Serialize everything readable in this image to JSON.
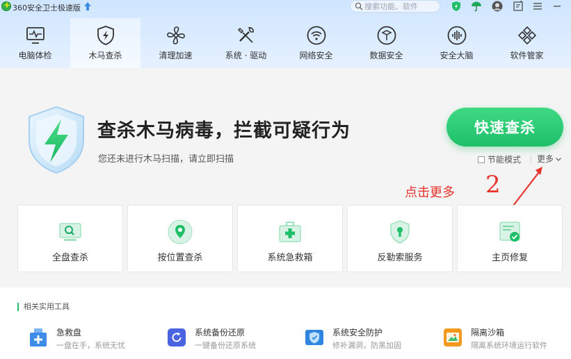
{
  "app": {
    "title": "360安全卫士极速版"
  },
  "search": {
    "placeholder": "搜索功能、软件"
  },
  "nav": [
    {
      "label": "电脑体检"
    },
    {
      "label": "木马查杀"
    },
    {
      "label": "清理加速"
    },
    {
      "label": "系统 · 驱动"
    },
    {
      "label": "网络安全"
    },
    {
      "label": "数据安全"
    },
    {
      "label": "安全大脑"
    },
    {
      "label": "软件管家"
    }
  ],
  "hero": {
    "headline": "查杀木马病毒，拦截可疑行为",
    "subtext": "您还未进行木马扫描，请立即扫描",
    "scan_button": "快速查杀",
    "power_save": "节能模式",
    "more": "更多"
  },
  "annotation": {
    "text": "点击更多",
    "number": "2",
    "color": "#e8332b"
  },
  "cards": [
    {
      "label": "全盘查杀"
    },
    {
      "label": "按位置查杀"
    },
    {
      "label": "系统急救箱"
    },
    {
      "label": "反勒索服务"
    },
    {
      "label": "主页修复"
    }
  ],
  "related": {
    "title": "相关实用工具",
    "tools": [
      {
        "name": "急救盘",
        "desc": "一盘在手，系统无忧"
      },
      {
        "name": "系统备份还原",
        "desc": "一键备份还原系统"
      },
      {
        "name": "系统安全防护",
        "desc": "修补漏洞，防黑加固"
      },
      {
        "name": "隔离沙箱",
        "desc": "隔离系统环境运行软件"
      }
    ]
  },
  "colors": {
    "accent": "#1fbf6a",
    "nav_bg": "#dcecff",
    "annotation": "#e8332b"
  }
}
